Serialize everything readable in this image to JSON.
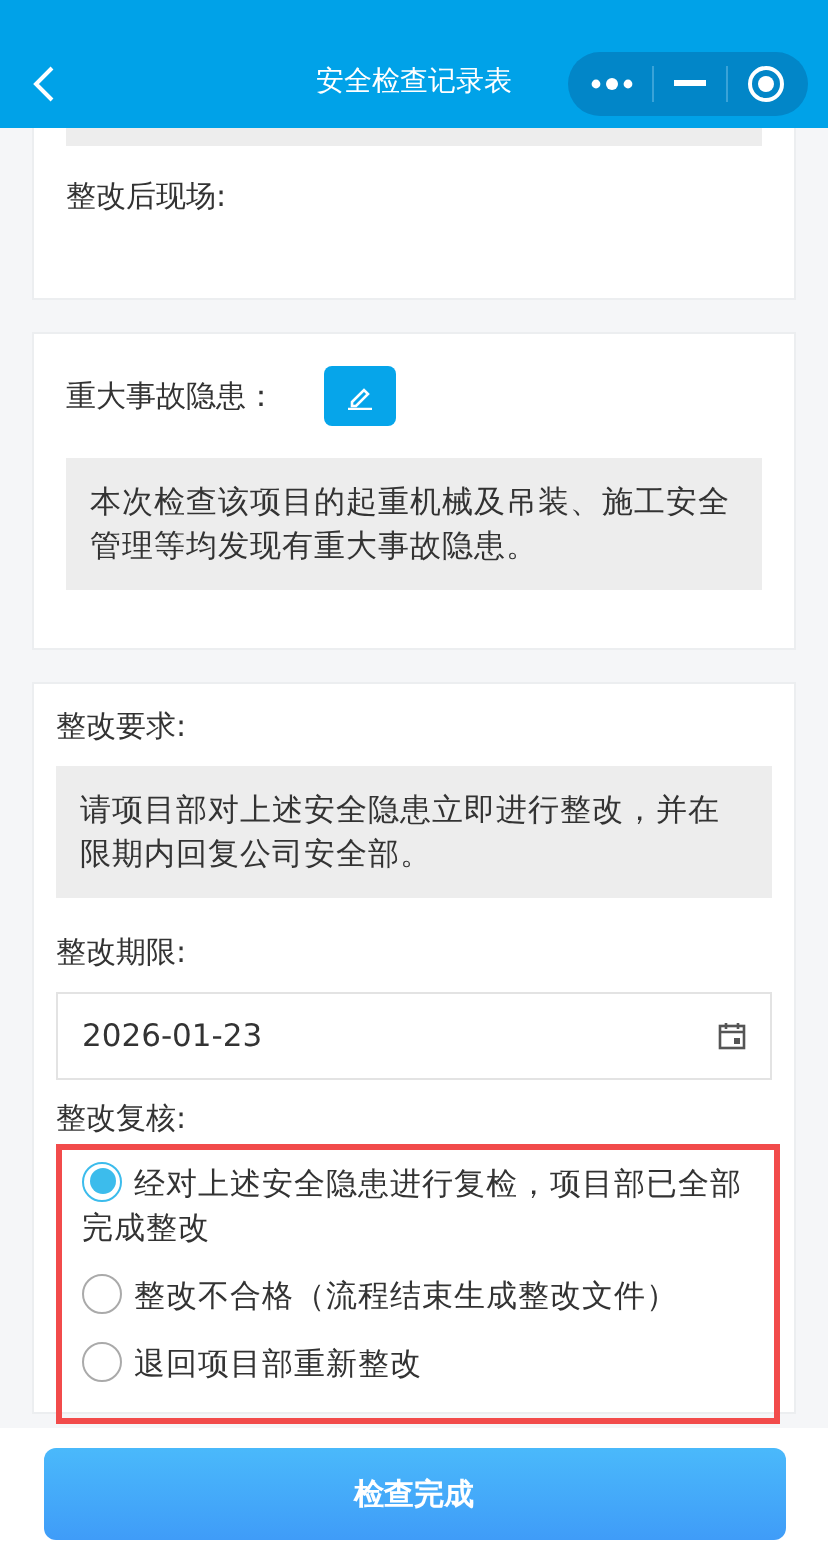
{
  "header": {
    "title": "安全检查记录表"
  },
  "after_section": {
    "label": "整改后现场:"
  },
  "hazard_section": {
    "label": "重大事故隐患：",
    "text": "本次检查该项目的起重机械及吊装、施工安全管理等均发现有重大事故隐患。"
  },
  "requirement": {
    "label": "整改要求:",
    "text": "请项目部对上述安全隐患立即进行整改，并在限期内回复公司安全部。"
  },
  "deadline": {
    "label": "整改期限:",
    "value": "2026-01-23"
  },
  "review": {
    "label": "整改复核:",
    "options": [
      {
        "label": "经对上述安全隐患进行复检，项目部已全部完成整改",
        "selected": true
      },
      {
        "label": "整改不合格（流程结束生成整改文件）",
        "selected": false
      },
      {
        "label": "退回项目部重新整改",
        "selected": false
      }
    ]
  },
  "submit": {
    "label": "检查完成"
  }
}
